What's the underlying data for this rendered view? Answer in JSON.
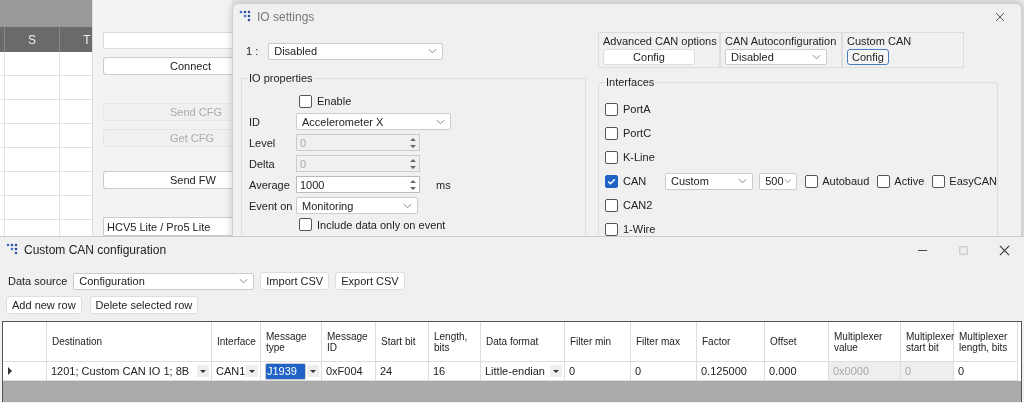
{
  "spreadsheet": {
    "columns": [
      "S",
      "T"
    ]
  },
  "main_panel": {
    "button_groups": [
      [
        {
          "label": "Connect",
          "disabled": false
        }
      ],
      [
        {
          "label": "Send CFG",
          "disabled": true
        },
        {
          "label": "Get CFG",
          "disabled": true
        }
      ],
      [
        {
          "label": "Send FW",
          "disabled": false
        }
      ]
    ],
    "device_select": {
      "value": "HCV5 Lite / Pro5 Lite"
    }
  },
  "io_settings": {
    "title": "IO settings",
    "io_number": "1 :",
    "io_select": {
      "value": "Disabled"
    },
    "io_properties": {
      "title": "IO properties",
      "enable": {
        "label": "Enable",
        "checked": false
      },
      "fields": [
        {
          "label": "ID",
          "kind": "select",
          "value": "Accelerometer X"
        },
        {
          "label": "Level",
          "kind": "spin",
          "value": "0",
          "disabled": true
        },
        {
          "label": "Delta",
          "kind": "spin",
          "value": "0",
          "disabled": true
        },
        {
          "label": "Average",
          "kind": "spin",
          "value": "1000",
          "disabled": false,
          "unit": "ms"
        },
        {
          "label": "Event on",
          "kind": "select",
          "value": "Monitoring"
        }
      ],
      "include_data": {
        "label": "Include data only on event",
        "checked": false
      }
    },
    "option_groups": [
      {
        "title": "Advanced CAN options",
        "kind": "button",
        "value": "Config",
        "focused": false
      },
      {
        "title": "CAN Autoconfiguration",
        "kind": "select",
        "value": "Disabled",
        "focused": false
      },
      {
        "title": "Custom CAN",
        "kind": "button",
        "value": "Config",
        "focused": true
      }
    ],
    "interfaces": {
      "title": "Interfaces",
      "items": [
        {
          "label": "PortA",
          "checked": false
        },
        {
          "label": "PortC",
          "checked": false
        },
        {
          "label": "K-Line",
          "checked": false
        },
        {
          "label": "CAN",
          "checked": true,
          "protocol": {
            "value": "Custom"
          },
          "speed": {
            "value": "500"
          },
          "options": [
            {
              "label": "Autobaud",
              "checked": false
            },
            {
              "label": "Active",
              "checked": false
            },
            {
              "label": "EasyCAN",
              "checked": false
            }
          ]
        },
        {
          "label": "CAN2",
          "checked": false
        },
        {
          "label": "1-Wire",
          "checked": false
        }
      ]
    }
  },
  "custom_can": {
    "title": "Custom CAN configuration",
    "data_source": {
      "label": "Data source",
      "value": "Configuration"
    },
    "file_buttons": [
      "Import CSV",
      "Export CSV"
    ],
    "row_buttons": [
      "Add new row",
      "Delete selected row"
    ],
    "table": {
      "columns": [
        "Destination",
        "Interface",
        "Message type",
        "Message ID",
        "Start bit",
        "Length, bits",
        "Data format",
        "Filter min",
        "Filter max",
        "Factor",
        "Offset",
        "Multiplexer value",
        "Multiplexer start bit",
        "Multiplexer length, bits"
      ],
      "rows": [
        {
          "cells": [
            {
              "value": "1201; Custom CAN IO 1; 8B",
              "kind": "dropdown",
              "disabled": false,
              "selected": false
            },
            {
              "value": "CAN1",
              "kind": "dropdown",
              "disabled": false,
              "selected": false
            },
            {
              "value": "J1939",
              "kind": "dropdown",
              "disabled": false,
              "selected": true
            },
            {
              "value": "0xF004",
              "kind": "text",
              "disabled": false,
              "selected": false
            },
            {
              "value": "24",
              "kind": "text",
              "disabled": false,
              "selected": false
            },
            {
              "value": "16",
              "kind": "text",
              "disabled": false,
              "selected": false
            },
            {
              "value": "Little-endian",
              "kind": "dropdown",
              "disabled": false,
              "selected": false
            },
            {
              "value": "0",
              "kind": "text",
              "disabled": false,
              "selected": false
            },
            {
              "value": "0",
              "kind": "text",
              "disabled": false,
              "selected": false
            },
            {
              "value": "0.125000",
              "kind": "text",
              "disabled": false,
              "selected": false
            },
            {
              "value": "0.000",
              "kind": "text",
              "disabled": false,
              "selected": false
            },
            {
              "value": "0x0000",
              "kind": "text",
              "disabled": true,
              "selected": false
            },
            {
              "value": "0",
              "kind": "text",
              "disabled": true,
              "selected": false
            },
            {
              "value": "0",
              "kind": "text",
              "disabled": false,
              "selected": false
            }
          ]
        }
      ]
    }
  }
}
